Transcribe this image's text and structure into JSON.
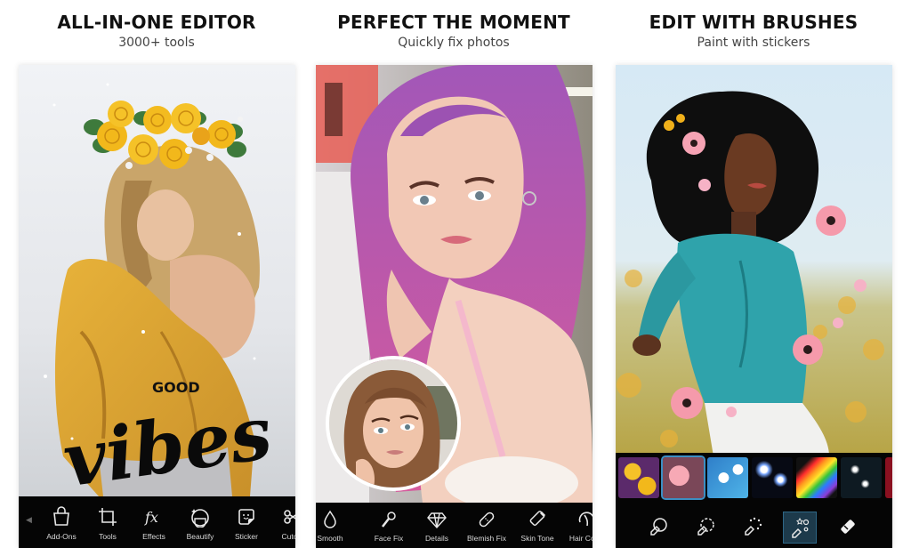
{
  "panels": [
    {
      "title": "ALL-IN-ONE EDITOR",
      "subtitle": "3000+ tools",
      "overlay_text": {
        "small": "GOOD",
        "script": "vibes"
      },
      "toolbar": {
        "scroll_left_icon": "chevron-left",
        "items": [
          {
            "label": "Add-Ons",
            "icon": "shopping-bag"
          },
          {
            "label": "Tools",
            "icon": "crop"
          },
          {
            "label": "Effects",
            "icon": "fx"
          },
          {
            "label": "Beautify",
            "icon": "face-sparkle"
          },
          {
            "label": "Sticker",
            "icon": "sticker"
          },
          {
            "label": "Cutout",
            "icon": "scissors"
          }
        ]
      }
    },
    {
      "title": "PERFECT THE MOMENT",
      "subtitle": "Quickly fix photos",
      "toolbar": {
        "items": [
          {
            "label": "Smooth",
            "icon": "droplet"
          },
          {
            "label": "Face Fix",
            "icon": "brush-wand"
          },
          {
            "label": "Details",
            "icon": "diamond"
          },
          {
            "label": "Blemish Fix",
            "icon": "bandage"
          },
          {
            "label": "Skin Tone",
            "icon": "tube"
          },
          {
            "label": "Hair Color",
            "icon": "hair"
          }
        ]
      }
    },
    {
      "title": "EDIT WITH BRUSHES",
      "subtitle": "Paint with stickers",
      "stickers": [
        {
          "name": "yellow-roses",
          "selected": false
        },
        {
          "name": "pink-flowers",
          "selected": true
        },
        {
          "name": "white-blossoms",
          "selected": false
        },
        {
          "name": "blue-sparkles",
          "selected": false
        },
        {
          "name": "rainbow",
          "selected": false
        },
        {
          "name": "white-sparkles",
          "selected": false
        },
        {
          "name": "red-hearts",
          "selected": false
        }
      ],
      "brushes": [
        {
          "name": "brush-circle",
          "selected": false
        },
        {
          "name": "brush-dashed",
          "selected": false
        },
        {
          "name": "brush-dots",
          "selected": false
        },
        {
          "name": "brush-sticker",
          "selected": true
        },
        {
          "name": "eraser",
          "selected": false
        }
      ]
    }
  ],
  "colors": {
    "toolbar_bg": "#050505",
    "selected_outline": "#3c8fc3",
    "selected_brush_bg": "#1d3a4b"
  }
}
